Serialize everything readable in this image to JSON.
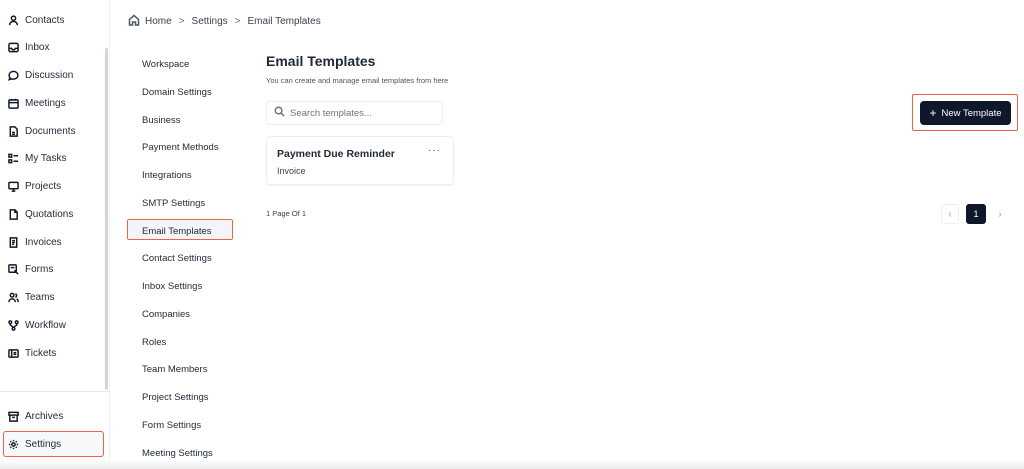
{
  "nav": {
    "items": [
      {
        "label": "Contacts",
        "icon": "person-icon"
      },
      {
        "label": "Inbox",
        "icon": "inbox-icon"
      },
      {
        "label": "Discussion",
        "icon": "chat-bubble-icon"
      },
      {
        "label": "Meetings",
        "icon": "calendar-icon"
      },
      {
        "label": "Documents",
        "icon": "document-icon"
      },
      {
        "label": "My Tasks",
        "icon": "tasks-icon"
      },
      {
        "label": "Projects",
        "icon": "projects-icon"
      },
      {
        "label": "Quotations",
        "icon": "file-icon"
      },
      {
        "label": "Invoices",
        "icon": "invoice-icon"
      },
      {
        "label": "Forms",
        "icon": "forms-icon"
      },
      {
        "label": "Teams",
        "icon": "teams-icon"
      },
      {
        "label": "Workflow",
        "icon": "workflow-icon"
      },
      {
        "label": "Tickets",
        "icon": "ticket-icon"
      }
    ],
    "archives": "Archives",
    "settings": "Settings"
  },
  "breadcrumb": {
    "home": "Home",
    "settings": "Settings",
    "current": "Email Templates"
  },
  "settings_menu": [
    "Workspace",
    "Domain Settings",
    "Business",
    "Payment Methods",
    "Integrations",
    "SMTP Settings",
    "Email Templates",
    "Contact Settings",
    "Inbox Settings",
    "Companies",
    "Roles",
    "Team Members",
    "Project Settings",
    "Form Settings",
    "Meeting Settings"
  ],
  "main": {
    "title": "Email Templates",
    "subtitle": "You can create and manage email templates from here",
    "search_placeholder": "Search templates...",
    "new_button": "New Template",
    "card": {
      "title": "Payment Due Reminder",
      "subtitle": "Invoice",
      "more": "···"
    },
    "page_info": "1 Page Of 1",
    "current_page": "1"
  },
  "colors": {
    "accent": "#0f172a",
    "highlight": "#f0624a"
  }
}
